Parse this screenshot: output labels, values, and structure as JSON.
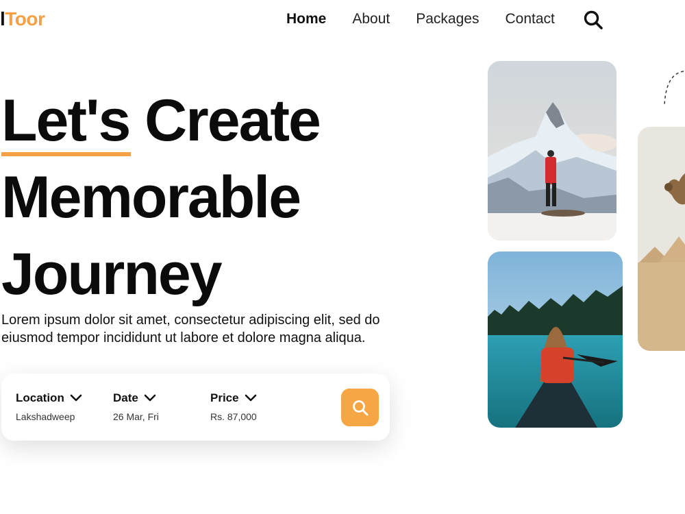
{
  "header": {
    "logo_part1": "l",
    "logo_part2": "Toor",
    "nav": [
      "Home",
      "About",
      "Packages",
      "Contact"
    ],
    "search_icon": "search-icon"
  },
  "hero": {
    "title_word1": "Let's",
    "title_line1_rest": " Create",
    "title_line2": "Memorable",
    "title_line3": "Journey",
    "description": "Lorem ipsum dolor sit amet, consectetur adipiscing elit, sed do eiusmod tempor incididunt ut labore et dolore magna aliqua."
  },
  "search": {
    "location_label": "Location",
    "location_value": "Lakshadweep",
    "date_label": "Date",
    "date_value": "26 Mar, Fri",
    "price_label": "Price",
    "price_value": "Rs. 87,000",
    "button_icon": "search-icon"
  },
  "colors": {
    "accent": "#f5a044",
    "text": "#111111",
    "background": "#ffffff"
  },
  "images": [
    "mountain-hiker-image",
    "lake-canoe-image",
    "desert-camel-image"
  ]
}
